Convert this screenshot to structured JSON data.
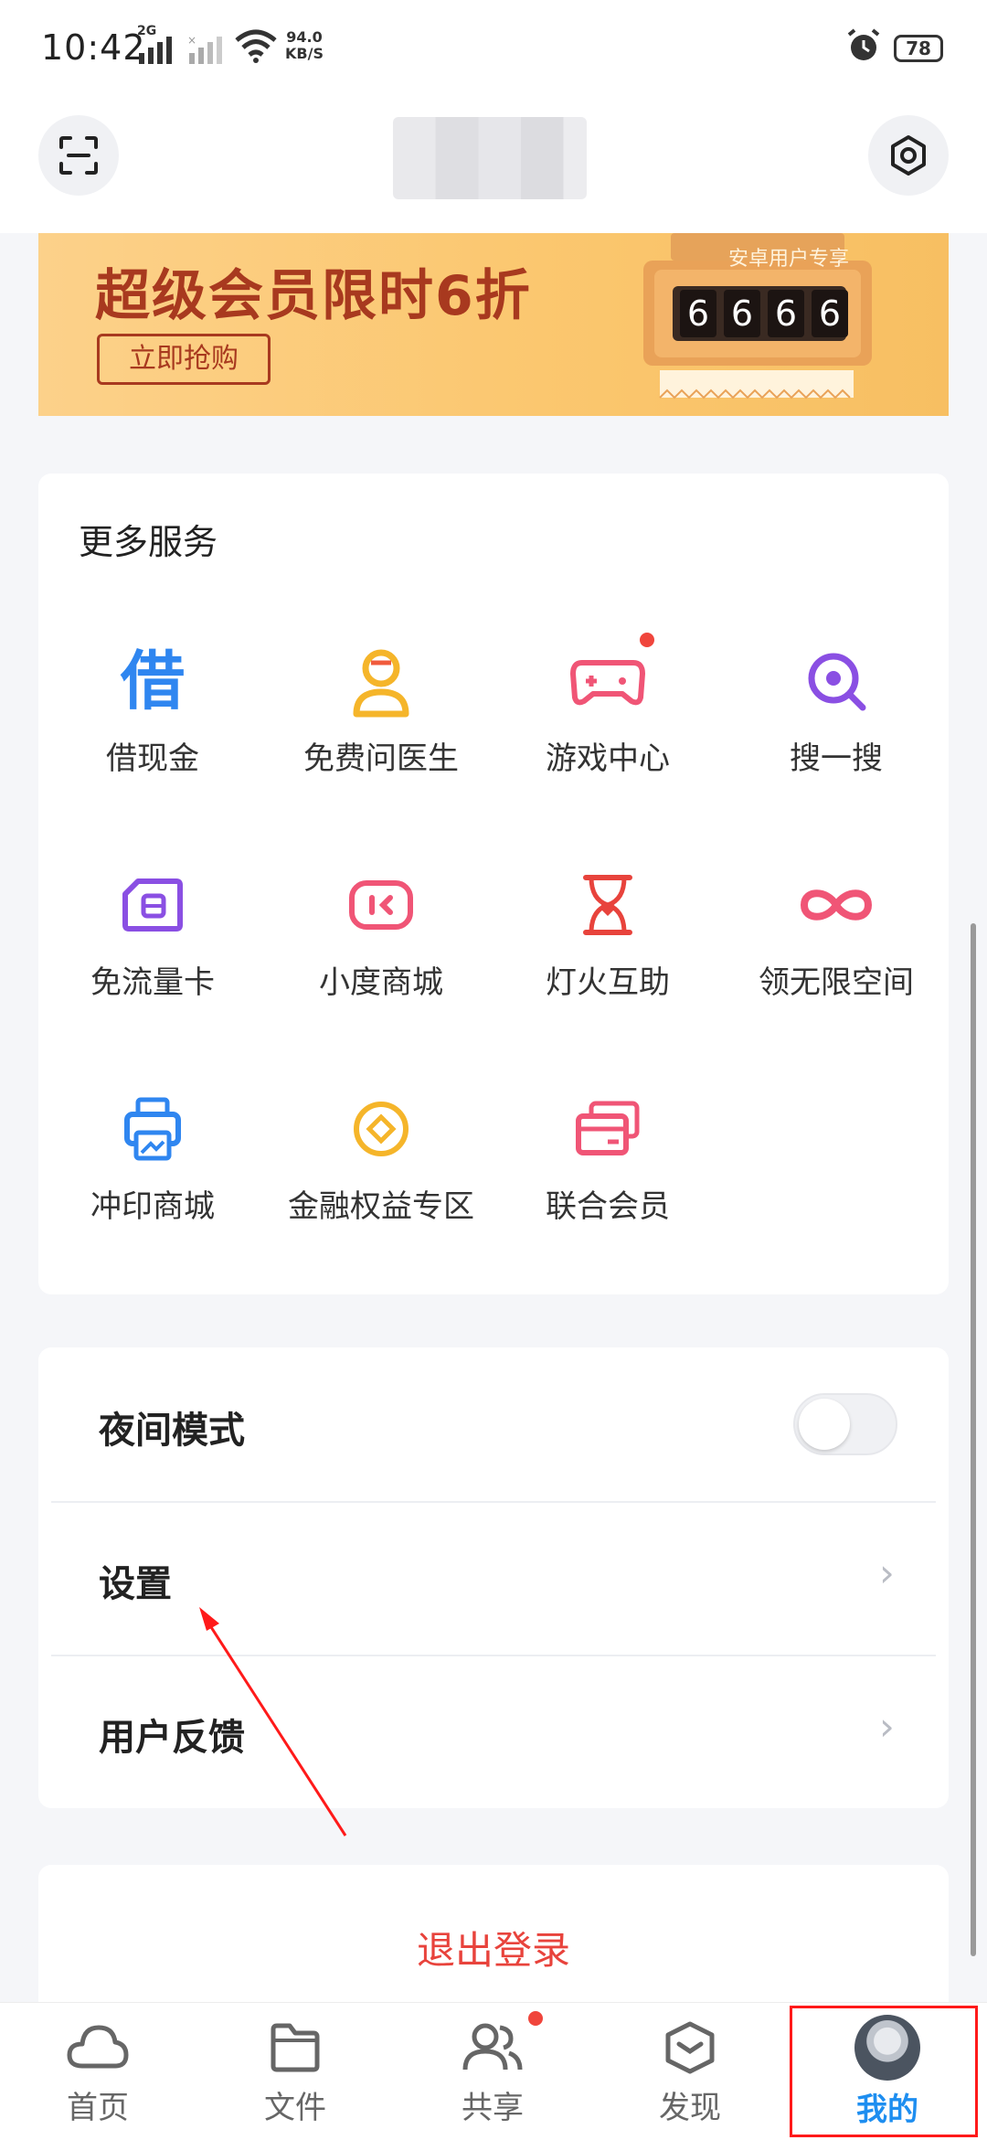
{
  "status_bar": {
    "time": "10:42",
    "network_type": "2G",
    "speed_value": "94.0",
    "speed_unit": "KB/S",
    "battery": "78"
  },
  "banner": {
    "title": "超级会员限时6折",
    "button": "立即抢购",
    "badge": "安卓用户专享",
    "digits": [
      "6",
      "6",
      "6",
      "6"
    ]
  },
  "services": {
    "title": "更多服务",
    "items": [
      {
        "label": "借现金",
        "icon": "borrow-icon",
        "color": "#2f86f0"
      },
      {
        "label": "免费问医生",
        "icon": "doctor-icon",
        "color": "#f5b52a"
      },
      {
        "label": "游戏中心",
        "icon": "gamepad-icon",
        "color": "#f05576",
        "badge": true
      },
      {
        "label": "搜一搜",
        "icon": "search-icon",
        "color": "#8a4fe3"
      },
      {
        "label": "免流量卡",
        "icon": "sim-card-icon",
        "color": "#8a4fe3"
      },
      {
        "label": "小度商城",
        "icon": "xiaodu-icon",
        "color": "#f05576"
      },
      {
        "label": "灯火互助",
        "icon": "hourglass-heart-icon",
        "color": "#e8433c"
      },
      {
        "label": "领无限空间",
        "icon": "infinity-icon",
        "color": "#f05576"
      },
      {
        "label": "冲印商城",
        "icon": "printer-icon",
        "color": "#2f86f0"
      },
      {
        "label": "金融权益专区",
        "icon": "coin-icon",
        "color": "#f5b52a"
      },
      {
        "label": "联合会员",
        "icon": "cards-icon",
        "color": "#f05576"
      }
    ]
  },
  "settings": {
    "night_mode": "夜间模式",
    "night_mode_on": false,
    "settings": "设置",
    "feedback": "用户反馈"
  },
  "logout": "退出登录",
  "tabs": [
    {
      "label": "首页",
      "icon": "cloud-icon"
    },
    {
      "label": "文件",
      "icon": "folder-icon"
    },
    {
      "label": "共享",
      "icon": "share-people-icon",
      "badge": true
    },
    {
      "label": "发现",
      "icon": "discover-icon"
    },
    {
      "label": "我的",
      "icon": "avatar",
      "active": true
    }
  ],
  "colors": {
    "accent_blue": "#1e8ef0",
    "logout_red": "#e8433c",
    "banner_text": "#a8391f",
    "annotation_red": "#ff1a1a"
  }
}
